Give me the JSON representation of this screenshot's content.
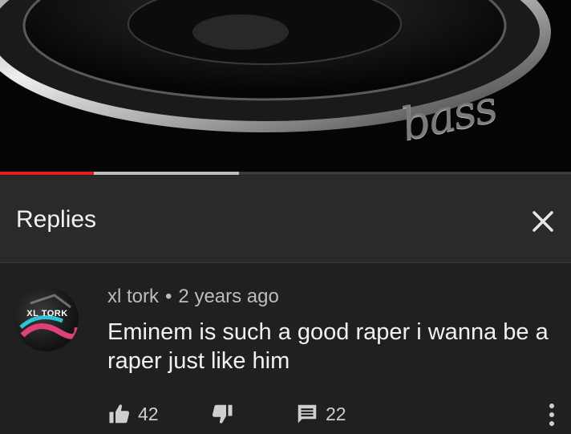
{
  "video": {
    "watermark": "bass",
    "progress": {
      "played_fraction": 0.165,
      "buffered_fraction": 0.418
    }
  },
  "replies": {
    "title": "Replies",
    "close_icon": "close-icon"
  },
  "comment": {
    "avatar_text": "XL TORK",
    "author": "xl tork",
    "separator": "•",
    "time": "2 years ago",
    "text": "Eminem is such a good raper i wanna be a raper just like him",
    "likes": "42",
    "replies_count": "22",
    "icons": [
      "thumbs-up-icon",
      "thumbs-down-icon",
      "reply-icon",
      "more-vertical-icon"
    ]
  },
  "colors": {
    "background": "#202020",
    "header_background": "#2a2a2a",
    "progress_played": "#e02020",
    "progress_buffer": "#bdbdbd"
  }
}
